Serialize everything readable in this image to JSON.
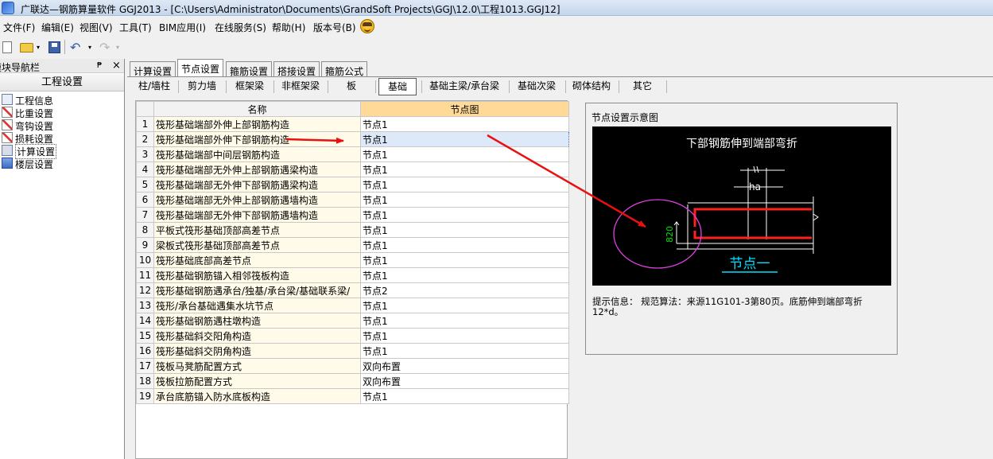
{
  "window": {
    "title": "广联达—钢筋算量软件 GGJ2013 - [C:\\Users\\Administrator\\Documents\\GrandSoft Projects\\GGJ\\12.0\\工程1013.GGJ12]"
  },
  "menu": [
    "文件(F)",
    "编辑(E)",
    "视图(V)",
    "工具(T)",
    "BIM应用(I)",
    "在线服务(S)",
    "帮助(H)",
    "版本号(B)"
  ],
  "toolbar": {
    "buttons": [
      "new-icon",
      "open-folder-icon",
      "save-icon",
      "undo-icon",
      "redo-icon"
    ],
    "dropdown_glyph": "▾"
  },
  "nav": {
    "title": "模块导航栏",
    "pin_glyph": "ꟷ",
    "close_glyph": "×",
    "section": "工程设置",
    "items": [
      {
        "label": "工程信息",
        "icon": "document-icon"
      },
      {
        "label": "比重设置",
        "icon": "pen-icon"
      },
      {
        "label": "弯钩设置",
        "icon": "pen-icon"
      },
      {
        "label": "损耗设置",
        "icon": "pen-icon"
      },
      {
        "label": "计算设置",
        "icon": "calculator-icon"
      },
      {
        "label": "楼层设置",
        "icon": "floors-icon"
      }
    ]
  },
  "tabs": [
    "计算设置",
    "节点设置",
    "箍筋设置",
    "搭接设置",
    "箍筋公式"
  ],
  "subtabs": [
    "柱/墙柱",
    "剪力墙",
    "框架梁",
    "非框架梁",
    "板",
    "基础",
    "基础主梁/承台梁",
    "基础次梁",
    "砌体结构",
    "其它"
  ],
  "table": {
    "headers": [
      "",
      "名称",
      "节点图"
    ],
    "rows": [
      {
        "no": "1",
        "name": "筏形基础端部外伸上部钢筋构造",
        "value": "节点1"
      },
      {
        "no": "2",
        "name": "筏形基础端部外伸下部钢筋构造",
        "value": "节点1"
      },
      {
        "no": "3",
        "name": "筏形基础端部中间层钢筋构造",
        "value": "节点1"
      },
      {
        "no": "4",
        "name": "筏形基础端部无外伸上部钢筋遇梁构造",
        "value": "节点1"
      },
      {
        "no": "5",
        "name": "筏形基础端部无外伸下部钢筋遇梁构造",
        "value": "节点1"
      },
      {
        "no": "6",
        "name": "筏形基础端部无外伸上部钢筋遇墙构造",
        "value": "节点1"
      },
      {
        "no": "7",
        "name": "筏形基础端部无外伸下部钢筋遇墙构造",
        "value": "节点1"
      },
      {
        "no": "8",
        "name": "平板式筏形基础顶部高差节点",
        "value": "节点1"
      },
      {
        "no": "9",
        "name": "梁板式筏形基础顶部高差节点",
        "value": "节点1"
      },
      {
        "no": "10",
        "name": "筏形基础底部高差节点",
        "value": "节点1"
      },
      {
        "no": "11",
        "name": "筏形基础钢筋锚入相邻筏板构造",
        "value": "节点1"
      },
      {
        "no": "12",
        "name": "筏形基础钢筋遇承台/独基/承台梁/基础联系梁/",
        "value": "节点2"
      },
      {
        "no": "13",
        "name": "筏形/承台基础遇集水坑节点",
        "value": "节点1"
      },
      {
        "no": "14",
        "name": "筏形基础钢筋遇柱墩构造",
        "value": "节点1"
      },
      {
        "no": "15",
        "name": "筏形基础斜交阳角构造",
        "value": "节点1"
      },
      {
        "no": "16",
        "name": "筏形基础斜交阴角构造",
        "value": "节点1"
      },
      {
        "no": "17",
        "name": "筏板马凳筋配置方式",
        "value": "双向布置"
      },
      {
        "no": "18",
        "name": "筏板拉筋配置方式",
        "value": "双向布置"
      },
      {
        "no": "19",
        "name": "承台底筋锚入防水底板构造",
        "value": "节点1"
      }
    ],
    "selected_row": 2
  },
  "preview": {
    "title": "节点设置示意图",
    "diagram_title": "下部钢筋伸到端部弯折",
    "dim_ha": "ha",
    "dim_value": "820",
    "node_label": "节点一",
    "hint": "提示信息： 规范算法：来源11G101-3第80页。底筋伸到端部弯折12*d。"
  },
  "colors": {
    "header_highlight": "#ffd998",
    "name_cell": "#fffbe8",
    "rebar": "#ff2020",
    "dimension_text": "#00e000",
    "node_label": "#00e0ff",
    "annotation_ellipse": "#e040e0",
    "annotation_arrow": "#e81010"
  }
}
